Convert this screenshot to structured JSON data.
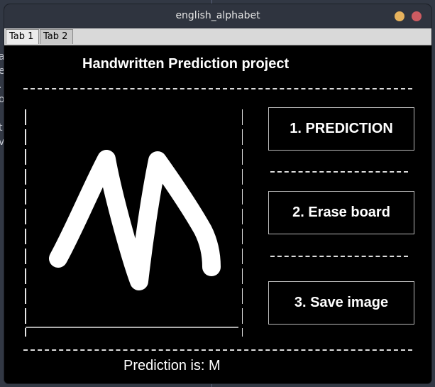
{
  "window": {
    "title": "english_alphabet"
  },
  "tabs": [
    {
      "label": "Tab 1",
      "active": true
    },
    {
      "label": "Tab 2",
      "active": false
    }
  ],
  "main": {
    "heading": "Handwritten Prediction project",
    "buttons": {
      "predict": "1. PREDICTION",
      "erase": "2. Erase board",
      "save": "3. Save image"
    },
    "prediction_label": "Prediction is: M"
  },
  "desktop": {
    "side_text": "a\ne\n.\no\n\nt\nv"
  },
  "colors": {
    "background": "#000000",
    "stroke": "#ffffff",
    "titlebar": "#2f343f",
    "minimize": "#e6b25d",
    "close": "#cc5b61"
  }
}
